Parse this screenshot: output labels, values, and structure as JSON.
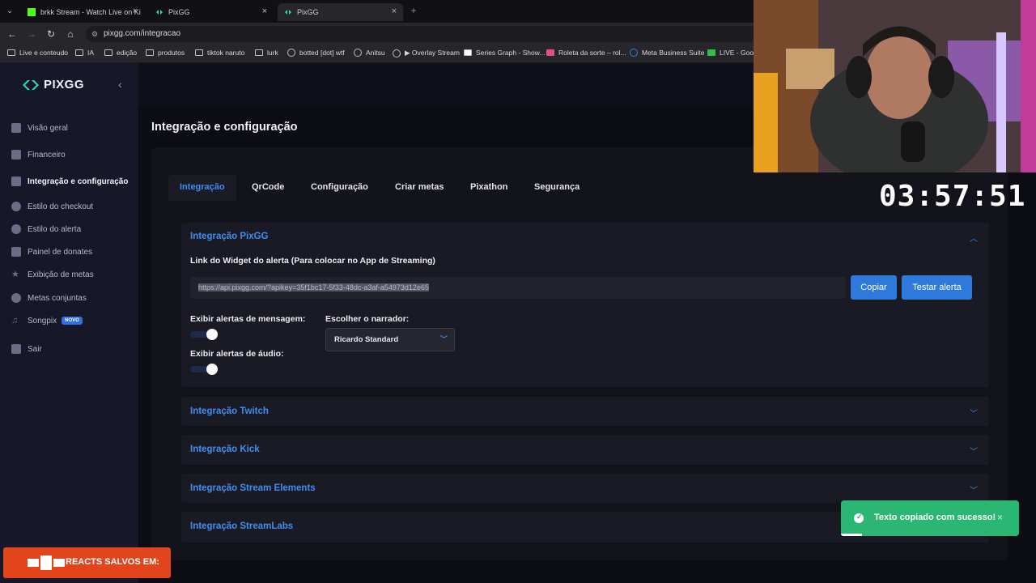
{
  "browser": {
    "tabs": [
      {
        "title": "brkk Stream - Watch Live on Ki",
        "active": false
      },
      {
        "title": "PixGG",
        "active": false
      },
      {
        "title": "PixGG",
        "active": true
      }
    ],
    "new_tab": "+",
    "url": "pixgg.com/integracao",
    "bookmarks": [
      "Live e conteudo",
      "IA",
      "edição",
      "produtos",
      "tiktok naruto",
      "lurk",
      "botted [dot] wtf",
      "Anitsu",
      "▶ Overlay Stream",
      "Series Graph - Show...",
      "Roleta da sorte – rol...",
      "Meta Business Suite",
      "LIVE - Goog"
    ]
  },
  "app": {
    "logo": "PIXGG",
    "sidebar": [
      {
        "label": "Visão geral"
      },
      {
        "label": "Financeiro"
      },
      {
        "label": "Integração e configuração",
        "active": true
      },
      {
        "label": "Estilo do checkout"
      },
      {
        "label": "Estilo do alerta"
      },
      {
        "label": "Painel de donates"
      },
      {
        "label": "Exibição de metas"
      },
      {
        "label": "Metas conjuntas"
      },
      {
        "label": "Songpix",
        "badge": "NOVO"
      },
      {
        "label": "Sair"
      }
    ],
    "page_title": "Integração e configuração",
    "tabs": [
      "Integração",
      "QrCode",
      "Configuração",
      "Criar metas",
      "Pixathon",
      "Segurança"
    ],
    "pixgg_panel": {
      "title": "Integração PixGG",
      "widget_label": "Link do Widget do alerta (Para colocar no App de Streaming)",
      "widget_url": "https://api.pixgg.com/?apikey=35f1bc17-5f33-48dc-a3af-a54973d12e65",
      "copy_button": "Copiar",
      "test_button": "Testar alerta",
      "message_alerts_label": "Exibir alertas de mensagem:",
      "audio_alerts_label": "Exibir alertas de áudio:",
      "narrator_label": "Escolher o narrador:",
      "narrator_value": "Ricardo Standard"
    },
    "panels": [
      "Integração Twitch",
      "Integração Kick",
      "Integração Stream Elements",
      "Integração StreamLabs"
    ]
  },
  "overlay": {
    "timer": "03:57:51",
    "toast": "Texto copiado com sucesso!",
    "toast_close": "×",
    "reacts_label": "REACTS SALVOS EM:"
  },
  "colors": {
    "accent": "#3e8ef2",
    "button": "#2e79dc",
    "toast": "#2bb673",
    "reacts": "#e2451b"
  }
}
